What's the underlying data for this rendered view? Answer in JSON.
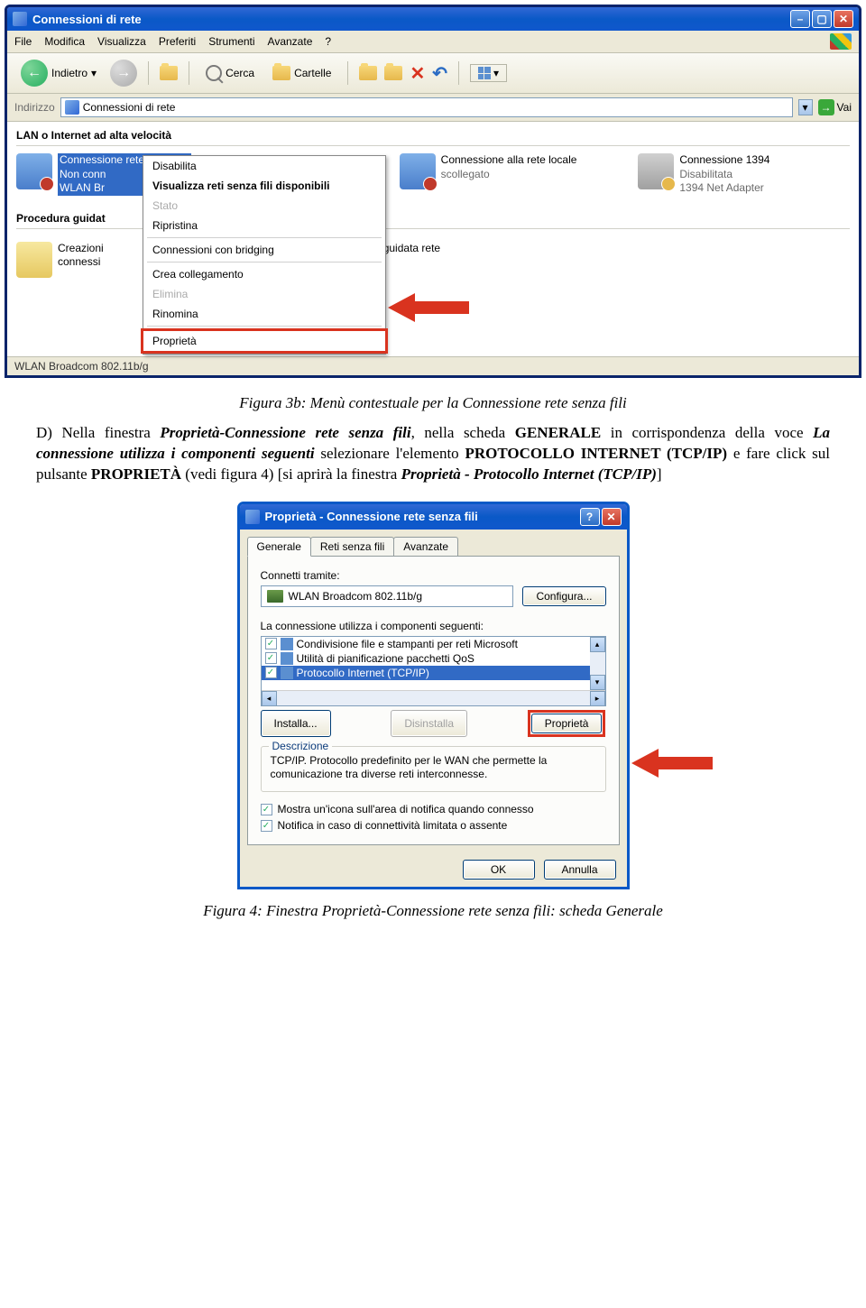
{
  "explorer": {
    "title": "Connessioni di rete",
    "menu": [
      "File",
      "Modifica",
      "Visualizza",
      "Preferiti",
      "Strumenti",
      "Avanzate",
      "?"
    ],
    "toolbar": {
      "back": "Indietro",
      "search": "Cerca",
      "folders": "Cartelle"
    },
    "address_label": "Indirizzo",
    "address_value": "Connessioni di rete",
    "go_label": "Vai",
    "section_lan": "LAN o Internet ad alta velocità",
    "conn1": {
      "line1": "Connessione rete senza fili",
      "line2": "Non conn",
      "line3": "WLAN Br"
    },
    "conn2": {
      "line1": "Connessione alla rete locale",
      "line2": "scollegato",
      "line3": ""
    },
    "conn3": {
      "line1": "Connessione 1394",
      "line2": "Disabilitata",
      "line3": "1394 Net Adapter"
    },
    "section_wizard": "Procedura guidat",
    "wizard1_line1": "Creazioni",
    "wizard1_line2": "connessi",
    "wizard2_line1": "guidata rete",
    "context_menu": {
      "disable": "Disabilita",
      "view_networks": "Visualizza reti senza fili disponibili",
      "status": "Stato",
      "repair": "Ripristina",
      "bridge": "Connessioni con bridging",
      "shortcut": "Crea collegamento",
      "delete": "Elimina",
      "rename": "Rinomina",
      "properties": "Proprietà"
    },
    "statusbar": "WLAN Broadcom 802.11b/g"
  },
  "caption1": "Figura 3b: Menù contestuale per la Connessione rete senza fili",
  "paragraph": {
    "marker": "D)",
    "t1": "Nella finestra ",
    "t2": "Proprietà-Connessione rete senza fili",
    "t3": ", nella scheda ",
    "t4": "GENERALE",
    "t5": " in corrispondenza della voce ",
    "t6": "La connessione utilizza i componenti seguenti",
    "t7": " selezionare l'elemento ",
    "t8": "PROTOCOLLO INTERNET (TCP/IP)",
    "t9": " e fare click sul pulsante ",
    "t10": "PROPRIETÀ",
    "t11": " (vedi figura 4) [si aprirà la finestra ",
    "t12": "Proprietà - Protocollo Internet (TCP/IP)",
    "t13": "]"
  },
  "dialog": {
    "title": "Proprietà - Connessione rete senza fili",
    "tabs": [
      "Generale",
      "Reti senza fili",
      "Avanzate"
    ],
    "connect_via": "Connetti tramite:",
    "adapter": "WLAN Broadcom 802.11b/g",
    "configure_btn": "Configura...",
    "components_label": "La connessione utilizza i componenti seguenti:",
    "components": [
      {
        "label": "Condivisione file e stampanti per reti Microsoft",
        "checked": true,
        "selected": false
      },
      {
        "label": "Utilità di pianificazione pacchetti QoS",
        "checked": true,
        "selected": false
      },
      {
        "label": "Protocollo Internet (TCP/IP)",
        "checked": true,
        "selected": true
      }
    ],
    "install_btn": "Installa...",
    "uninstall_btn": "Disinstalla",
    "properties_btn": "Proprietà",
    "desc_title": "Descrizione",
    "desc_text": "TCP/IP. Protocollo predefinito per le WAN che permette la comunicazione tra diverse reti interconnesse.",
    "chk1": "Mostra un'icona sull'area di notifica quando connesso",
    "chk2": "Notifica in caso di connettività limitata o assente",
    "ok_btn": "OK",
    "cancel_btn": "Annulla"
  },
  "caption2": "Figura 4: Finestra Proprietà-Connessione rete senza fili: scheda Generale"
}
